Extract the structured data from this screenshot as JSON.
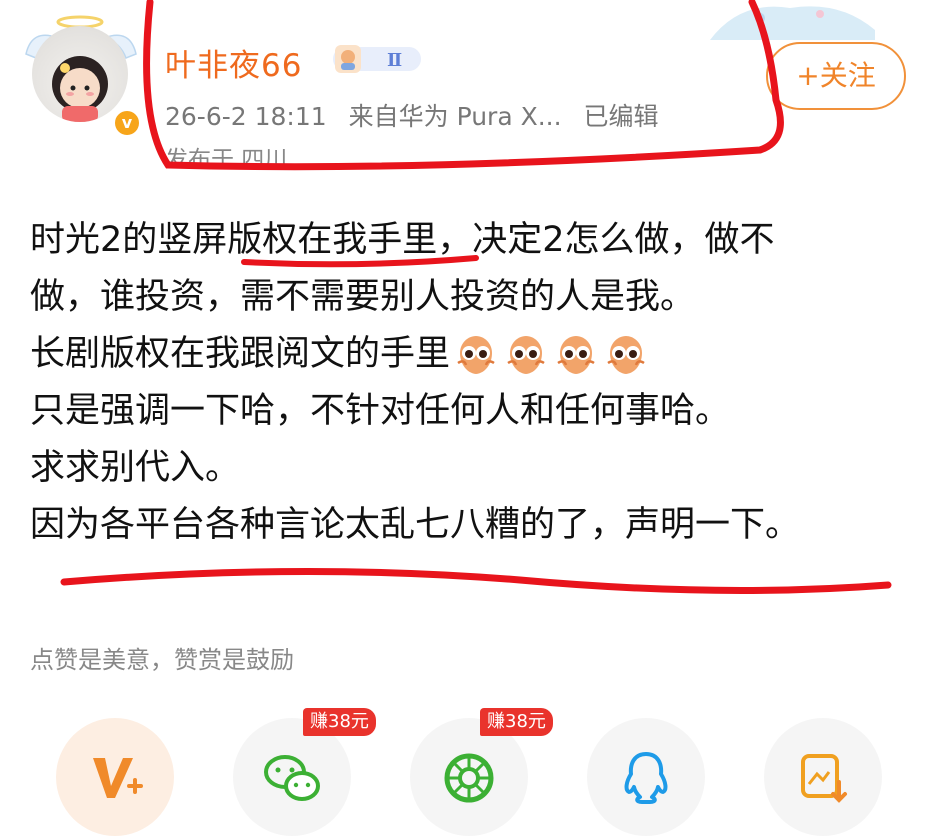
{
  "header": {
    "username": "叶非夜66",
    "level_badge": "Ⅱ",
    "verified_mark": "v",
    "timestamp": "26-6-2 18:11",
    "source": "来自华为 Pura X...",
    "edited": "已编辑",
    "location": "发布于 四川",
    "follow_label": "+关注"
  },
  "post": {
    "lines": [
      "时光2的竖屏版权在我手里，决定2怎么做，做不",
      "做，谁投资，需不需要别人投资的人是我。",
      "长剧版权在我跟阅文的手里",
      "只是强调一下哈，不针对任何人和任何事哈。",
      "求求别代入。",
      "因为各平台各种言论太乱七八糟的了，声明一下。"
    ],
    "emoji_count": 4,
    "emoji_icon": "staring-eyes-emoji"
  },
  "reward_tip": "点赞是美意，赞赏是鼓励",
  "share": {
    "items": [
      {
        "name": "vplus",
        "icon": "v-plus-icon"
      },
      {
        "name": "wechat",
        "icon": "wechat-icon",
        "badge": "赚38元"
      },
      {
        "name": "moments",
        "icon": "wechat-moments-icon",
        "badge": "赚38元"
      },
      {
        "name": "qq",
        "icon": "qq-icon"
      },
      {
        "name": "save-image",
        "icon": "save-image-icon"
      }
    ]
  },
  "colors": {
    "username": "#ef6a1e",
    "follow": "#f0842a",
    "red_markup": "#e8141c",
    "badge": "#e9332c",
    "wechat_green": "#3cb034"
  }
}
